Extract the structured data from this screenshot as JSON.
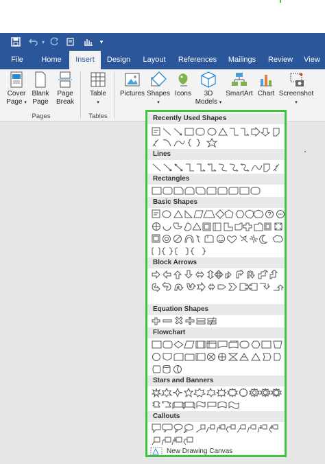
{
  "quick_access": {
    "save_icon": "save-icon",
    "undo_icon": "undo-icon",
    "redo_icon": "redo-icon",
    "touch_icon": "touch-mode-icon",
    "more_icon": "customize-icon"
  },
  "tabs": [
    {
      "label": "File",
      "active": false
    },
    {
      "label": "Home",
      "active": false
    },
    {
      "label": "Insert",
      "active": true
    },
    {
      "label": "Design",
      "active": false
    },
    {
      "label": "Layout",
      "active": false
    },
    {
      "label": "References",
      "active": false
    },
    {
      "label": "Mailings",
      "active": false
    },
    {
      "label": "Review",
      "active": false
    },
    {
      "label": "View",
      "active": false
    }
  ],
  "ribbon": {
    "cover_page": "Cover Page",
    "blank_page": "Blank Page",
    "page_break": "Page Break",
    "table": "Table",
    "pictures": "Pictures",
    "shapes": "Shapes",
    "icons": "Icons",
    "models_3d": "3D Models",
    "smartart": "SmartArt",
    "chart": "Chart",
    "screenshot": "Screenshot",
    "group_pages": "Pages",
    "group_tables": "Tables"
  },
  "shapes_menu": {
    "categories": [
      {
        "name": "Recently Used Shapes"
      },
      {
        "name": "Lines"
      },
      {
        "name": "Rectangles"
      },
      {
        "name": "Basic Shapes"
      },
      {
        "name": "Block Arrows"
      },
      {
        "name": "Equation Shapes"
      },
      {
        "name": "Flowchart"
      },
      {
        "name": "Stars and Banners"
      },
      {
        "name": "Callouts"
      }
    ],
    "footer": "New Drawing Canvas"
  },
  "colors": {
    "accent": "#2b579a",
    "highlight": "#3ec43e"
  }
}
